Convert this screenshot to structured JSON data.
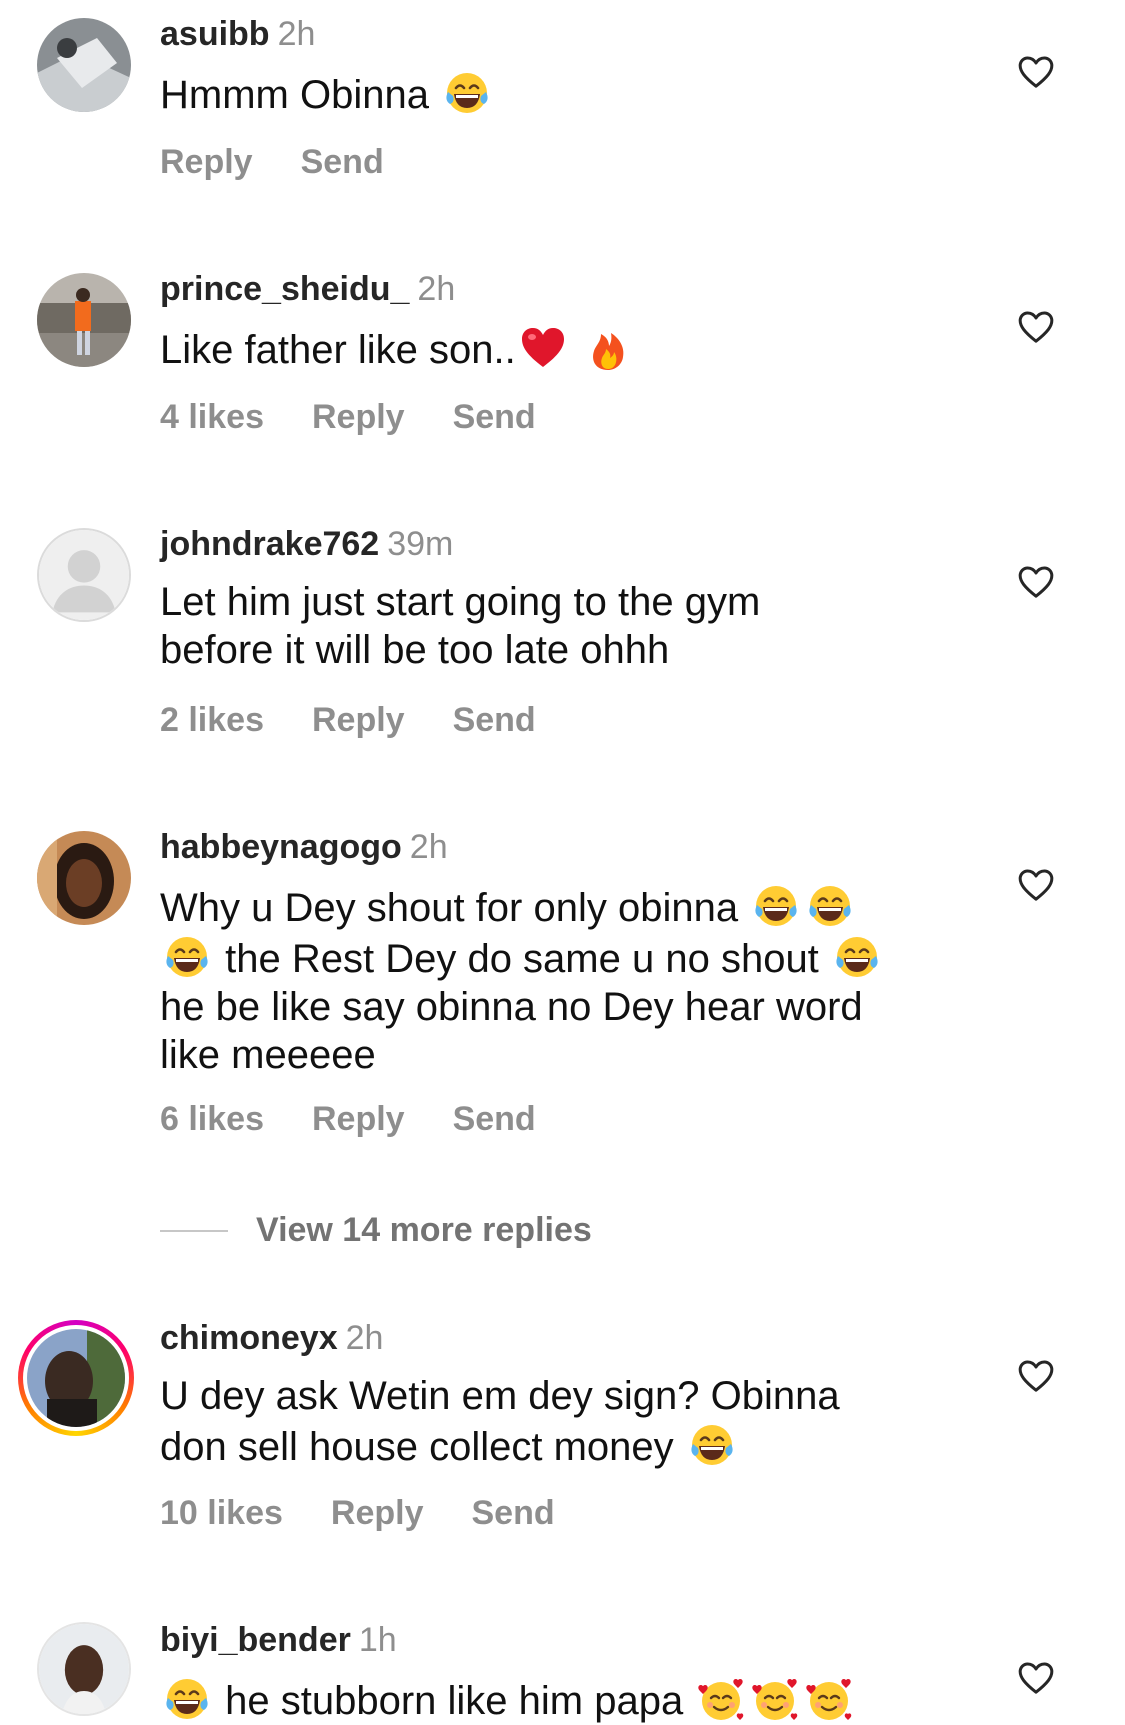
{
  "comments": [
    {
      "username": "asuibb",
      "time": "2h",
      "text_before": "Hmmm Obinna",
      "emoji_after": [
        "tears-of-joy"
      ],
      "likes": "",
      "reply": "Reply",
      "send": "Send"
    },
    {
      "username": "prince_sheidu_",
      "time": "2h",
      "text_before": "Like father like son..",
      "emoji_after": [
        "red-heart",
        "fire"
      ],
      "likes": "4 likes",
      "reply": "Reply",
      "send": "Send"
    },
    {
      "username": "johndrake762",
      "time": "39m",
      "line1": "Let him just start going to the gym",
      "line2": "before it will be too late ohhh",
      "likes": "2 likes",
      "reply": "Reply",
      "send": "Send"
    },
    {
      "username": "habbeynagogo",
      "time": "2h",
      "line1": "Why u Dey shout for only obinna",
      "line2": "the Rest Dey do same u no shout",
      "line3": "he be like say obinna no Dey hear word",
      "line4": "like meeeee",
      "likes": "6 likes",
      "reply": "Reply",
      "send": "Send"
    },
    {
      "username": "chimoneyx",
      "time": "2h",
      "line1": "U dey ask Wetin em dey sign? Obinna",
      "line2": "don sell house collect money",
      "likes": "10 likes",
      "reply": "Reply",
      "send": "Send"
    },
    {
      "username": "biyi_bender",
      "time": "1h",
      "line1": "he stubborn like him papa"
    }
  ],
  "view_more_replies": "View 14 more replies",
  "colors": {
    "username": "#262626",
    "secondary": "#8e8e8e",
    "story_ring": [
      "#d300c5",
      "#ff0069",
      "#ff7a00",
      "#ffd600"
    ]
  },
  "icons": {
    "like": "heart-outline-icon",
    "emoji_laugh": "tears-of-joy-emoji",
    "emoji_heart": "red-heart-emoji",
    "emoji_fire": "fire-emoji",
    "emoji_love": "smiling-face-with-hearts-emoji"
  }
}
